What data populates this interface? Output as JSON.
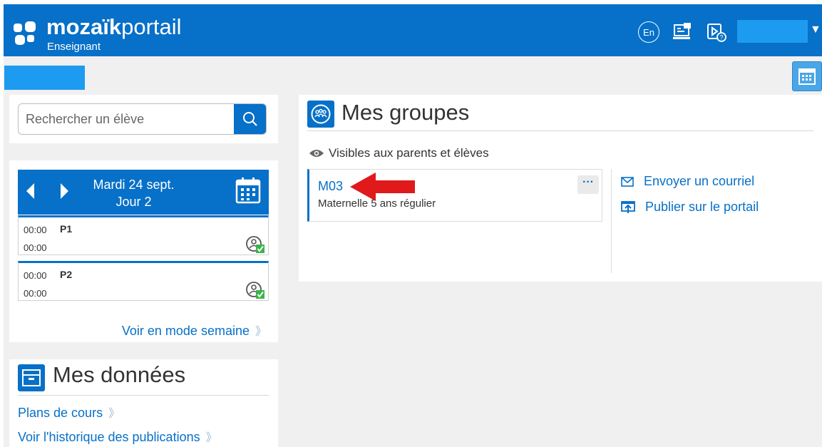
{
  "header": {
    "logo_bold": "mozaïk",
    "logo_light": "portail",
    "logo_sub": "Enseignant",
    "lang_button": "En",
    "icons": [
      "language-icon",
      "desktop-icon",
      "video-help-icon"
    ]
  },
  "search": {
    "placeholder": "Rechercher un élève"
  },
  "schedule": {
    "date": "Mardi 24 sept.",
    "day": "Jour 2",
    "periods": [
      {
        "start": "00:00",
        "end": "00:00",
        "name": "P1"
      },
      {
        "start": "00:00",
        "end": "00:00",
        "name": "P2"
      }
    ],
    "week_link": "Voir en mode semaine"
  },
  "data_section": {
    "title": "Mes données",
    "links": [
      "Plans de cours",
      "Voir l'historique des publications"
    ]
  },
  "groups": {
    "title": "Mes groupes",
    "visibility": "Visibles aux parents et élèves",
    "items": [
      {
        "code": "M03",
        "description": "Maternelle 5 ans régulier"
      }
    ],
    "more": "···",
    "actions": [
      "Envoyer un courriel",
      "Publier sur le portail"
    ]
  },
  "colors": {
    "primary": "#0770c8",
    "accent": "#1c9bf0",
    "arrow": "#e0191b",
    "status_green": "#3cb34a"
  }
}
